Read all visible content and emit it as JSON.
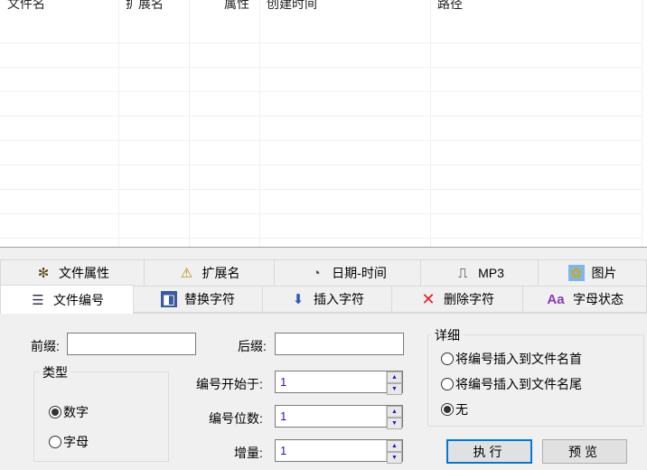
{
  "list": {
    "columns": [
      "文件名",
      "扩展名",
      "属性",
      "创建时间",
      "路径"
    ]
  },
  "tabs_row1": [
    {
      "label": "文件属性",
      "icon": "gear-cluster-icon"
    },
    {
      "label": "扩展名",
      "icon": "warning-file-icon"
    },
    {
      "label": "日期-时间",
      "icon": "clock-icon"
    },
    {
      "label": "MP3",
      "icon": "audio-file-icon"
    },
    {
      "label": "图片",
      "icon": "picture-icon"
    }
  ],
  "tabs_row2": [
    {
      "label": "文件编号",
      "icon": "numbered-list-icon"
    },
    {
      "label": "替换字符",
      "icon": "replace-icon"
    },
    {
      "label": "插入字符",
      "icon": "insert-arrow-icon"
    },
    {
      "label": "删除字符",
      "icon": "delete-x-icon"
    },
    {
      "label": "字母状态",
      "icon": "letter-case-icon",
      "glyph": "Aa"
    }
  ],
  "numbering": {
    "prefix_label": "前缀:",
    "prefix_value": "",
    "suffix_label": "后缀:",
    "suffix_value": "",
    "type_group": "类型",
    "type_options": [
      "数字",
      "字母"
    ],
    "start_label": "编号开始于:",
    "start_value": "1",
    "digits_label": "编号位数:",
    "digits_value": "1",
    "increment_label": "增量:",
    "increment_value": "1",
    "detail_group": "详细",
    "detail_options": [
      "将编号插入到文件名首",
      "将编号插入到文件名尾",
      "无"
    ],
    "execute": "执行",
    "preview": "预览"
  }
}
